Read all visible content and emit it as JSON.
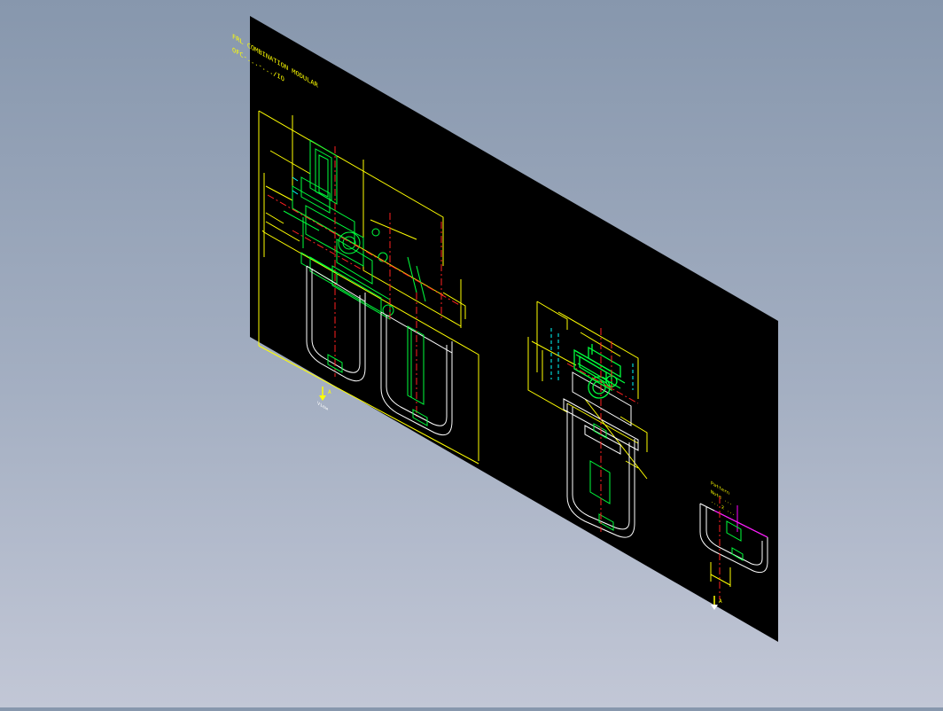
{
  "viewport": {
    "background_top": "#8797ad",
    "background_bottom": "#c2c7d6"
  },
  "sheet": {
    "background": "#000000",
    "title_line_1": "FRL COMBINATION MODULAR",
    "title_line_2": "OFC-...-.../IO",
    "colors": {
      "outline": "#ffff00",
      "solid": "#00ff3c",
      "axis": "#ff2020",
      "white": "#ffffff",
      "magenta": "#ff00ff",
      "cyan": "#00ffff"
    }
  },
  "annotations": {
    "view_marker_left": "A",
    "view_note_left": "View",
    "view_marker_right": "A",
    "right_note_1": "Pattern",
    "right_note_2": "Note ...",
    "right_note_3": "... 2 ..."
  }
}
